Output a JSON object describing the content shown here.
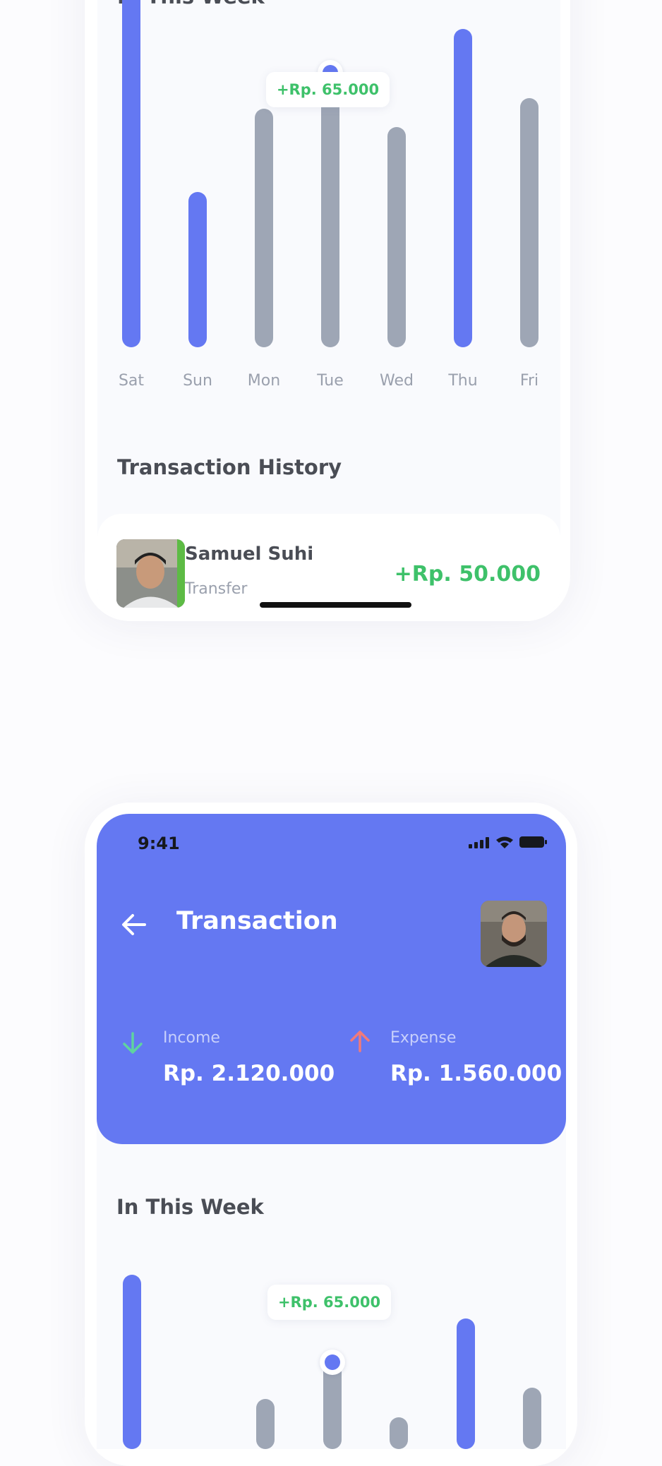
{
  "colors": {
    "accent": "#6478f2",
    "bar_inactive": "#9ea6b5",
    "positive": "#3ec16a",
    "income_arrow": "#5fd3a0",
    "expense_arrow": "#f07a7a"
  },
  "upper": {
    "section_title": "In This Week",
    "tooltip": "+Rp. 65.000",
    "history_title": "Transaction History",
    "transaction": {
      "name": "Samuel Suhi",
      "type": "Transfer",
      "amount": "+Rp. 50.000"
    }
  },
  "lower": {
    "status_time": "9:41",
    "title": "Transaction",
    "back_icon": "arrow-left-icon",
    "income": {
      "label": "Income",
      "value": "Rp. 2.120.000",
      "icon": "arrow-down-icon"
    },
    "expense": {
      "label": "Expense",
      "value": "Rp. 1.560.000",
      "icon": "arrow-up-icon"
    },
    "section_title": "In This Week",
    "tooltip": "+Rp. 65.000"
  },
  "chart_data": {
    "type": "bar",
    "categories": [
      "Sat",
      "Sun",
      "Mon",
      "Tue",
      "Wed",
      "Thu",
      "Fri"
    ],
    "values": [
      1.0,
      0.43,
      0.66,
      0.76,
      0.61,
      0.88,
      0.69
    ],
    "highlighted": [
      true,
      true,
      false,
      false,
      false,
      true,
      false
    ],
    "selected_index": 3,
    "selected_label": "+Rp. 65.000"
  }
}
